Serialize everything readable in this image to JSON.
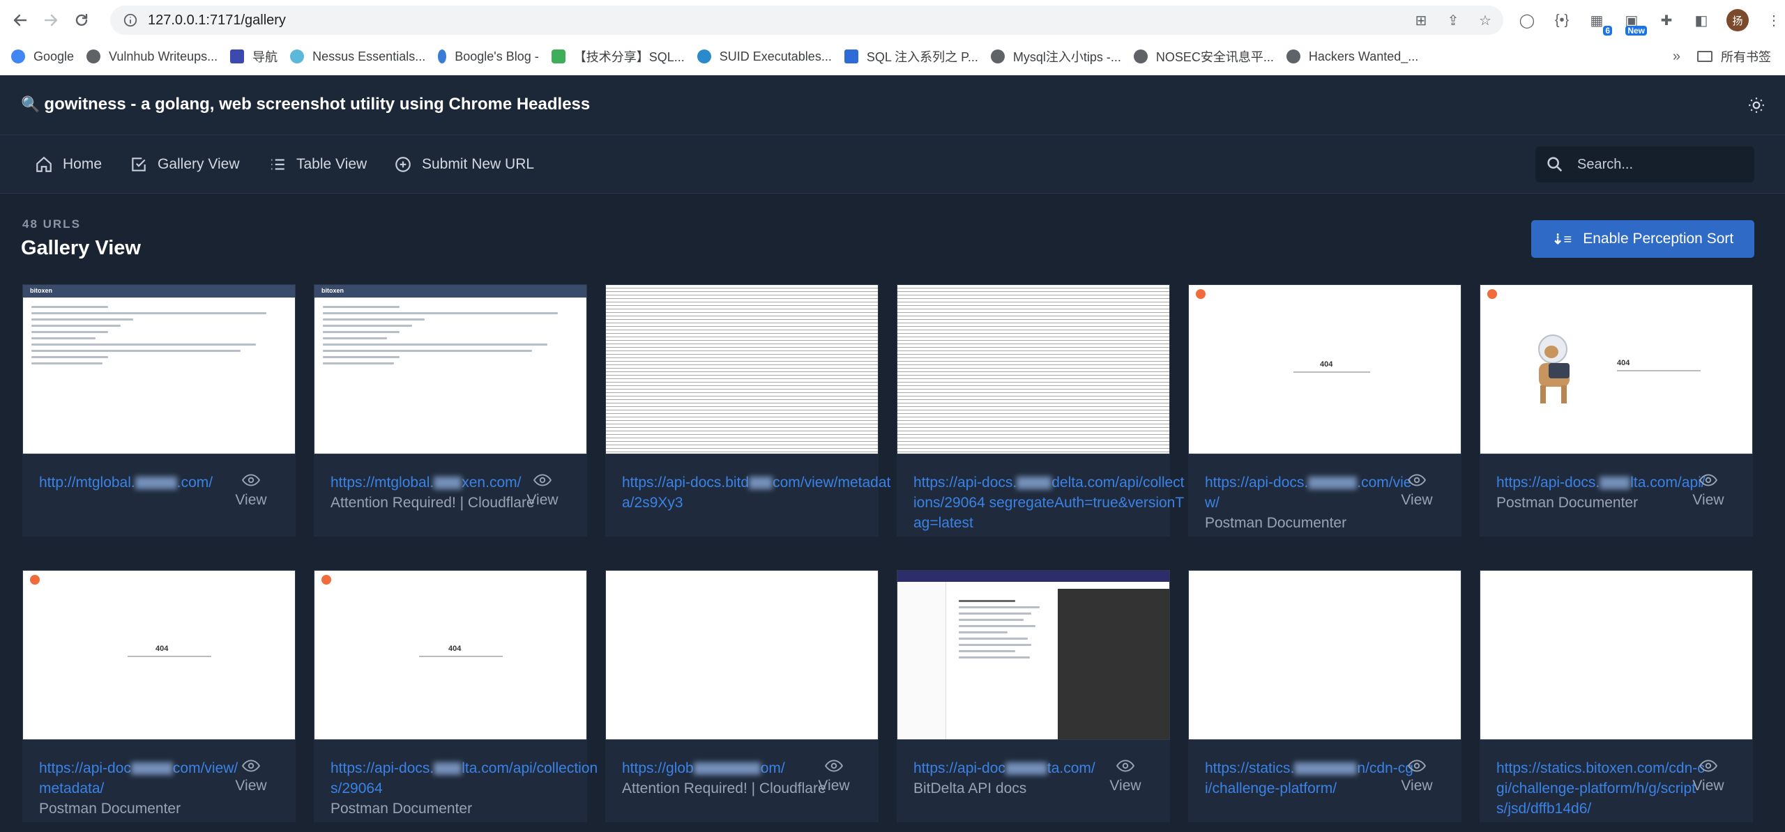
{
  "browser": {
    "url": "127.0.0.1:7171/gallery",
    "bookmarks": [
      {
        "label": "Google",
        "color": "#4285f4"
      },
      {
        "label": "Vulnhub Writeups...",
        "color": "#5f6368"
      },
      {
        "label": "导航",
        "color": "#3c4ab0"
      },
      {
        "label": "Nessus Essentials...",
        "color": "#5bb8d8"
      },
      {
        "label": "Boogle's Blog -",
        "color": "#3a7bd5"
      },
      {
        "label": "【技术分享】SQL...",
        "color": "#3fae5a"
      },
      {
        "label": "SUID Executables...",
        "color": "#2a8acb"
      },
      {
        "label": "SQL 注入系列之 P...",
        "color": "#2d6bd6"
      },
      {
        "label": "Mysql注入小tips -...",
        "color": "#5f6368"
      },
      {
        "label": "NOSEC安全讯息平...",
        "color": "#5f6368"
      },
      {
        "label": "Hackers Wanted_...",
        "color": "#5f6368"
      }
    ],
    "bookmarks_more": "»",
    "bookmarks_folder": "所有书签",
    "ext_badge_count": "6",
    "ext_badge_new": "New",
    "avatar_initial": "扬"
  },
  "app": {
    "title": "gowitness - a golang, web screenshot utility using Chrome Headless"
  },
  "nav": {
    "home": "Home",
    "gallery": "Gallery View",
    "table": "Table View",
    "submit": "Submit New URL",
    "search_placeholder": "Search..."
  },
  "main": {
    "count": "48 URLS",
    "title": "Gallery View",
    "perception_button": "Enable Perception Sort"
  },
  "view_label": "View",
  "cards": [
    {
      "url_a": "http://mtglobal.",
      "url_b": ".com/",
      "sub": "",
      "thumb": "bitoxen"
    },
    {
      "url_a": "https://mtglobal.",
      "url_b": "xen.com/",
      "sub": "Attention Required! | Cloudflare",
      "thumb": "bitoxen"
    },
    {
      "url_a": "https://api-docs.bitd",
      "url_b": "com/view/metadata/2s9Xy3",
      "sub": "",
      "thumb": "dense"
    },
    {
      "url_a": "https://api-docs.",
      "url_b": "delta.com/api/collections/29064",
      "sub": "segregateAuth=true&versionTag=latest",
      "thumb": "dense"
    },
    {
      "url_a": "https://api-docs.",
      "url_b": ".com/view/",
      "sub": "Postman Documenter",
      "thumb": "404"
    },
    {
      "url_a": "https://api-docs.",
      "url_b": "lta.com/api/",
      "sub": "Postman Documenter",
      "thumb": "dog"
    },
    {
      "url_a": "https://api-doc",
      "url_b": "com/view/metadata/",
      "sub": "Postman Documenter",
      "thumb": "404"
    },
    {
      "url_a": "https://api-docs.",
      "url_b": "lta.com/api/collections/29064",
      "sub": "Postman Documenter",
      "thumb": "404"
    },
    {
      "url_a": "https://glob",
      "url_b": "om/",
      "sub": "Attention Required! | Cloudflare",
      "thumb": "blank"
    },
    {
      "url_a": "https://api-doc",
      "url_b": "ta.com/",
      "sub": "BitDelta API docs",
      "thumb": "docs"
    },
    {
      "url_a": "https://statics.",
      "url_b": "n/cdn-cgi/challenge-platform/",
      "sub": "",
      "thumb": "blank"
    },
    {
      "url_a": "https://statics.bitoxen.com/cdn-cgi/challenge-platform/h/g/scripts/jsd/dffb14d6/",
      "url_b": "",
      "sub": "",
      "thumb": "blank"
    }
  ],
  "thumb_texts": {
    "brand": "bitoxen",
    "code": "404"
  }
}
